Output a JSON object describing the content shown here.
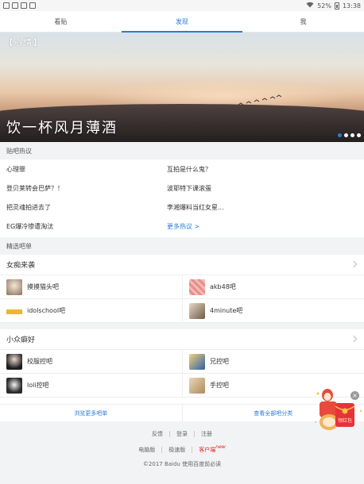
{
  "status_bar": {
    "battery": "52%",
    "time": "13:38"
  },
  "tabs": [
    {
      "label": "看贴",
      "active": false
    },
    {
      "label": "发现",
      "active": true
    },
    {
      "label": "我",
      "active": false
    }
  ],
  "banner": {
    "tag": "【心情】",
    "title": "饮一杯风月薄酒",
    "slide_count": 4,
    "active_slide": 1
  },
  "hot_topics": {
    "header": "贴吧热议",
    "items": [
      "心理罪",
      "互拍是什么鬼？",
      "登贝莱转会巴萨？！",
      "波耶特下课滚蛋",
      "把灵魂拍进去了",
      "李湘爆料当红女星...",
      "EG爆冷惨遭淘汰"
    ],
    "more": "更多热议 >"
  },
  "featured": {
    "header": "精选吧单",
    "groups": [
      {
        "title": "女痴来袭",
        "bars": [
          {
            "name": "摸摸猫头吧",
            "icon": "cat-thumbnail-icon"
          },
          {
            "name": "akb48吧",
            "icon": "akb48-thumbnail-icon"
          },
          {
            "name": "idolschool吧",
            "icon": "idolschool-thumbnail-icon"
          },
          {
            "name": "4minute吧",
            "icon": "4minute-thumbnail-icon"
          }
        ]
      },
      {
        "title": "小众癖好",
        "bars": [
          {
            "name": "校服控吧",
            "icon": "uniform-thumbnail-icon"
          },
          {
            "name": "兄控吧",
            "icon": "brother-thumbnail-icon"
          },
          {
            "name": "loli控吧",
            "icon": "loli-thumbnail-icon"
          },
          {
            "name": "手控吧",
            "icon": "hand-thumbnail-icon"
          }
        ]
      }
    ]
  },
  "browse": {
    "left": "浏览更多吧单",
    "right": "查看全部吧分类"
  },
  "footer": {
    "row1": [
      "反馈",
      "登录",
      "注册"
    ],
    "row2": [
      "电脑版",
      "极速版",
      "客户端"
    ],
    "new_badge": "new",
    "copyright": "©2017 Baidu 使用百度前必读"
  },
  "red_envelope": {
    "text": "领红包",
    "close": "×"
  },
  "colors": {
    "accent": "#2a7bd6",
    "section_bg": "#f2f3f5",
    "client_red": "#e02020"
  }
}
